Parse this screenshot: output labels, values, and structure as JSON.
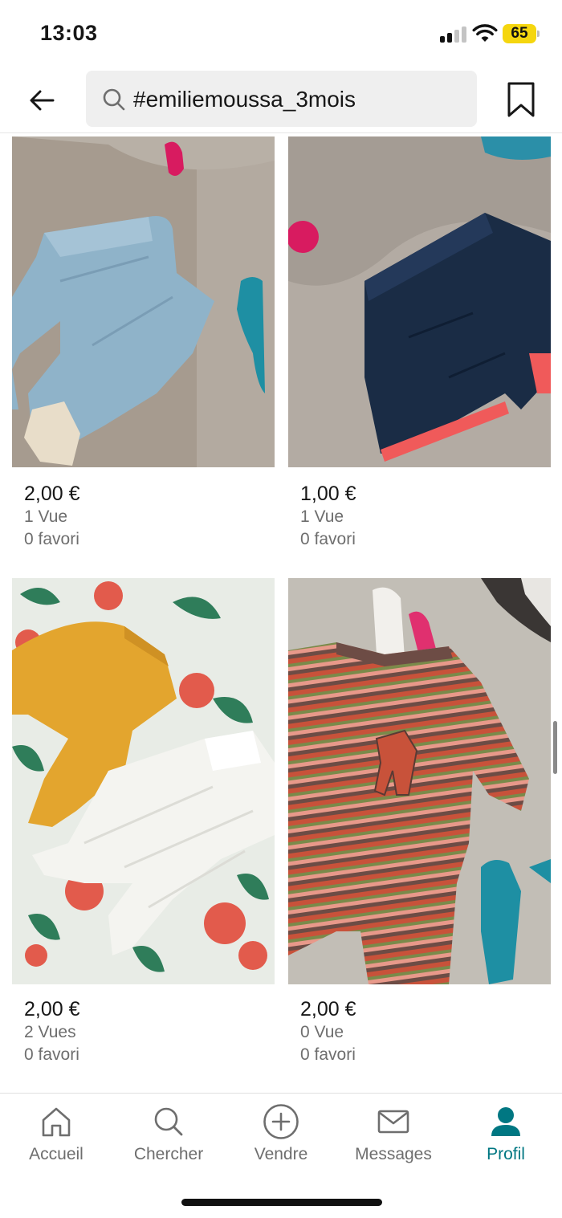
{
  "status_bar": {
    "time": "13:03",
    "battery": "65",
    "icons": [
      "signal-icon",
      "wifi-icon",
      "battery-icon"
    ]
  },
  "header": {
    "search_query": "#emiliemoussa_3mois",
    "icons": [
      "back-arrow-icon",
      "search-icon",
      "bookmark-icon"
    ]
  },
  "items": [
    {
      "price": "2,00 €",
      "views": "1 Vue",
      "favorites": "0 favori"
    },
    {
      "price": "1,00 €",
      "views": "1 Vue",
      "favorites": "0 favori"
    },
    {
      "price": "2,00 €",
      "views": "2 Vues",
      "favorites": "0 favori"
    },
    {
      "price": "2,00 €",
      "views": "0 Vue",
      "favorites": "0 favori"
    }
  ],
  "tabbar": {
    "accent_color": "#007782",
    "tabs": [
      {
        "label": "Accueil",
        "icon": "home-icon",
        "active": false
      },
      {
        "label": "Chercher",
        "icon": "search-icon",
        "active": false
      },
      {
        "label": "Vendre",
        "icon": "plus-circle-icon",
        "active": false
      },
      {
        "label": "Messages",
        "icon": "mail-icon",
        "active": false
      },
      {
        "label": "Profil",
        "icon": "profile-icon",
        "active": true
      }
    ]
  }
}
